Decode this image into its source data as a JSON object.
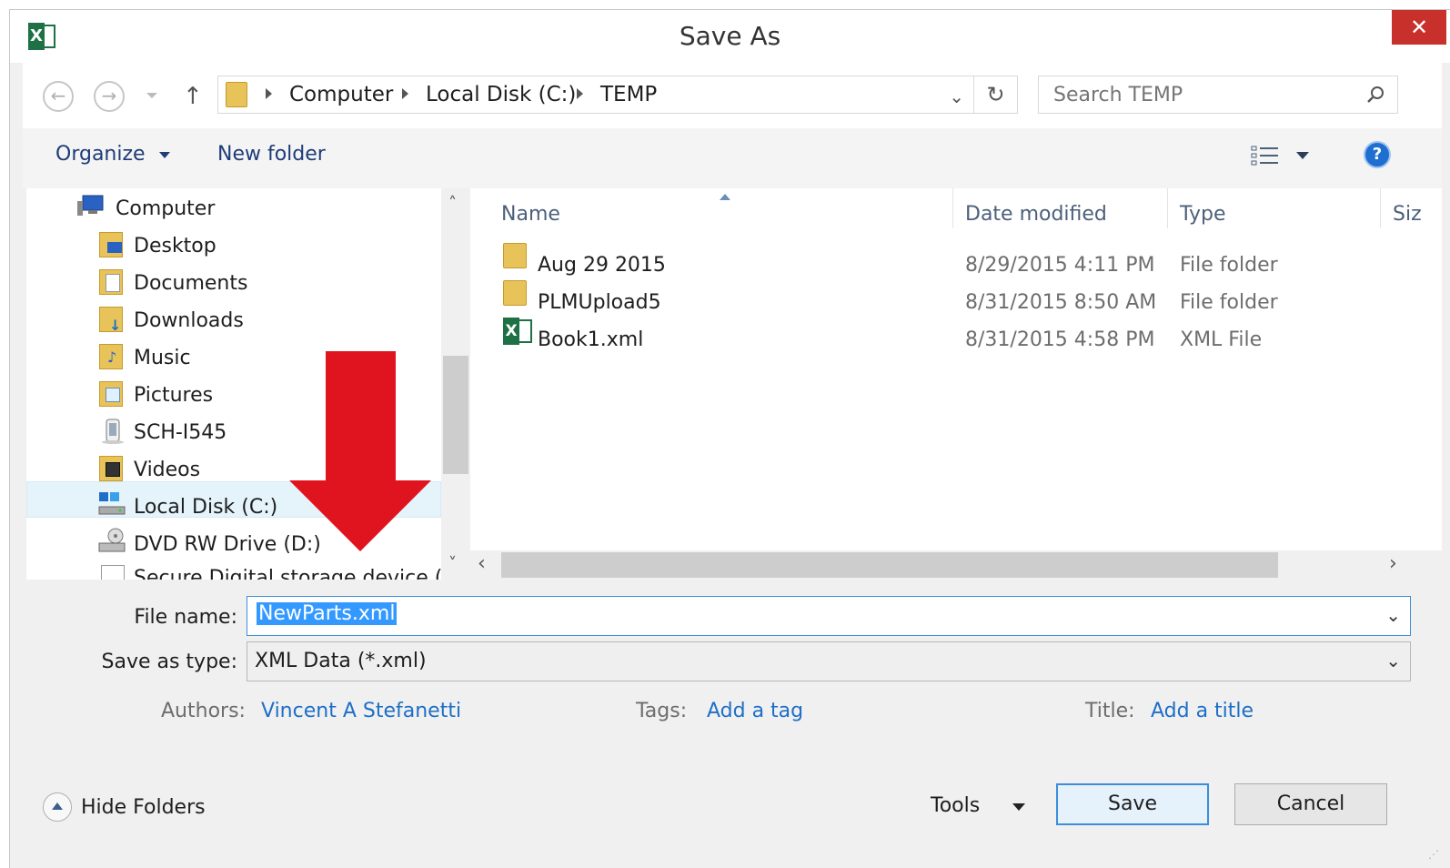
{
  "window": {
    "title": "Save As",
    "close_glyph": "✕"
  },
  "app_icon": {
    "name": "excel-icon",
    "letter": "X"
  },
  "nav": {
    "breadcrumb": [
      "Computer",
      "Local Disk (C:)",
      "TEMP"
    ],
    "search_placeholder": "Search TEMP"
  },
  "toolbar": {
    "organize_label": "Organize",
    "new_folder_label": "New folder"
  },
  "sidebar": {
    "items": [
      {
        "label": "Computer",
        "icon": "computer-icon"
      },
      {
        "label": "Desktop",
        "icon": "desktop-folder-icon"
      },
      {
        "label": "Documents",
        "icon": "documents-folder-icon"
      },
      {
        "label": "Downloads",
        "icon": "downloads-folder-icon"
      },
      {
        "label": "Music",
        "icon": "music-folder-icon"
      },
      {
        "label": "Pictures",
        "icon": "pictures-folder-icon"
      },
      {
        "label": "SCH-I545",
        "icon": "phone-icon"
      },
      {
        "label": "Videos",
        "icon": "videos-folder-icon"
      },
      {
        "label": "Local Disk (C:)",
        "icon": "local-disk-icon",
        "selected": true
      },
      {
        "label": "DVD RW Drive (D:)",
        "icon": "dvd-drive-icon"
      },
      {
        "label": "Secure Digital storage device (E:)",
        "icon": "sd-card-icon"
      }
    ]
  },
  "files": {
    "columns": [
      "Name",
      "Date modified",
      "Type",
      "Siz"
    ],
    "rows": [
      {
        "name": "Aug 29 2015",
        "date": "8/29/2015 4:11 PM",
        "type": "File folder",
        "icon": "folder-icon"
      },
      {
        "name": "PLMUpload5",
        "date": "8/31/2015 8:50 AM",
        "type": "File folder",
        "icon": "folder-icon"
      },
      {
        "name": "Book1.xml",
        "date": "8/31/2015 4:58 PM",
        "type": "XML File",
        "icon": "excel-file-icon"
      }
    ]
  },
  "form": {
    "file_name_label": "File name:",
    "file_name_value": "NewParts.xml",
    "save_type_label": "Save as type:",
    "save_type_value": "XML Data (*.xml)"
  },
  "meta": {
    "authors_label": "Authors:",
    "authors_value": "Vincent A Stefanetti",
    "tags_label": "Tags:",
    "tags_value": "Add a tag",
    "title_label": "Title:",
    "title_value": "Add a title"
  },
  "footer": {
    "hide_folders_label": "Hide Folders",
    "tools_label": "Tools",
    "save_label": "Save",
    "cancel_label": "Cancel"
  },
  "colors": {
    "annotation_arrow": "#e0141e",
    "close_button": "#c7302b",
    "link": "#1e6fc7",
    "selection": "#3399ff"
  }
}
